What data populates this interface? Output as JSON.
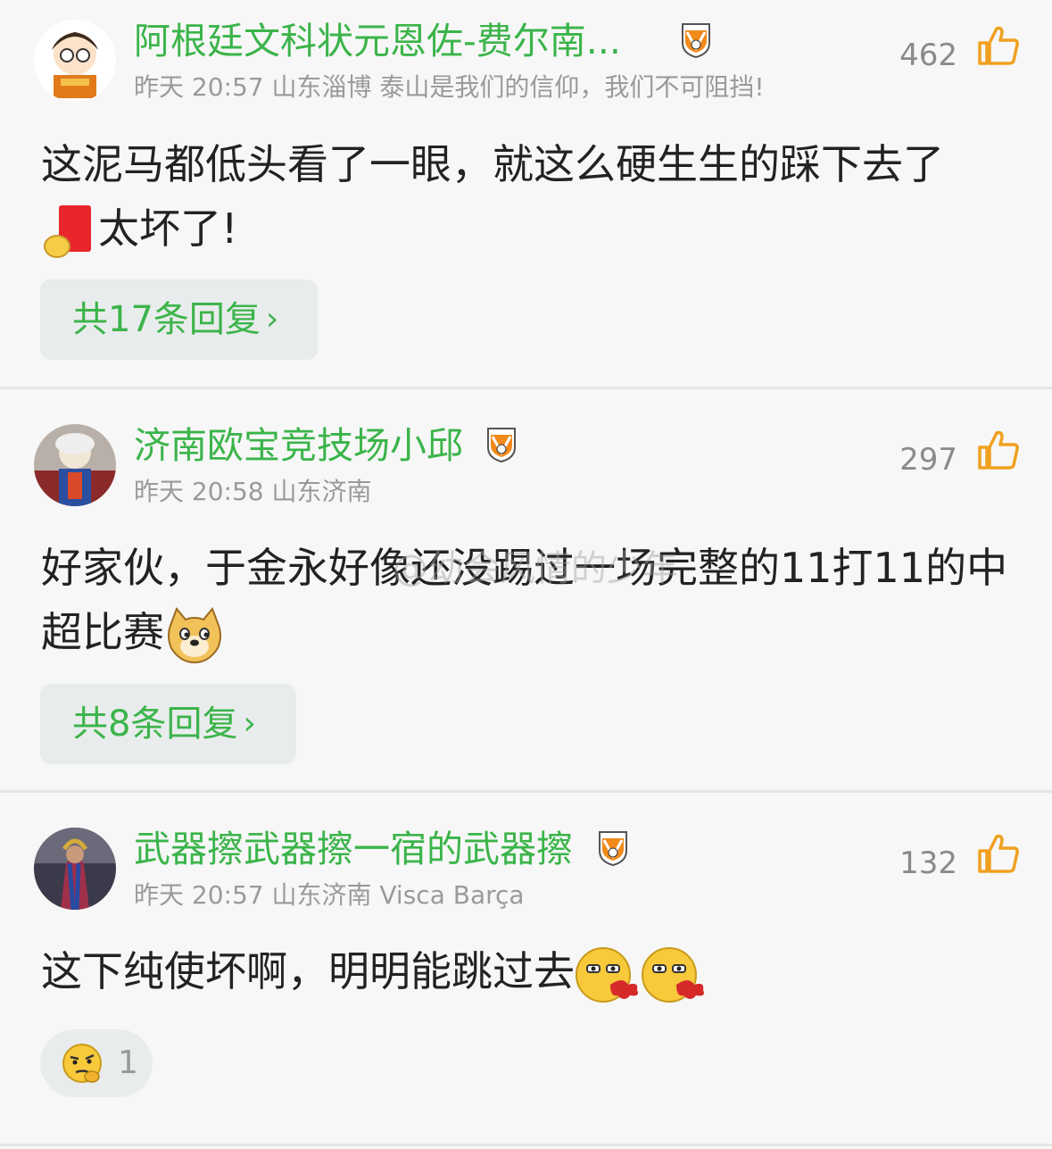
{
  "colors": {
    "accent_green": "#3bb44a",
    "meta_gray": "#9a9a9a",
    "like_orange": "#f0a020",
    "background": "#f7f7f7"
  },
  "watermark": "@幼会风情的少年",
  "comments": [
    {
      "username": "阿根廷文科状元恩佐-费尔南...",
      "badge_icon": "tsfc-badge-icon",
      "meta": "昨天 20:57 山东淄博 泰山是我们的信仰，我们不可阻挡!",
      "likes": "462",
      "text_line1": "这泥马都低头看了一眼，就这么硬生生的踩下去了",
      "text_line2": "太坏了!",
      "emoji_before_line2": "red-card-emoji",
      "reply_label": "共17条回复"
    },
    {
      "username": "济南欧宝竞技场小邱",
      "badge_icon": "tsfc-badge-icon",
      "meta": "昨天 20:58 山东济南",
      "likes": "297",
      "text_line1": "好家伙，于金永好像还没踢过一场完整的11打11的中",
      "text_line2": "超比赛",
      "emoji_after_line2": "doge-emoji",
      "reply_label": "共8条回复"
    },
    {
      "username": "武器擦武器擦一宿的武器擦",
      "badge_icon": "tsfc-badge-icon",
      "meta": "昨天 20:57 山东济南 Visca Barça",
      "likes": "132",
      "text_line1": "这下纯使坏啊，明明能跳过去",
      "emoji_after_line1": "spit-blood-emoji",
      "reaction_icon": "thinking-emoji",
      "reaction_count": "1"
    }
  ]
}
